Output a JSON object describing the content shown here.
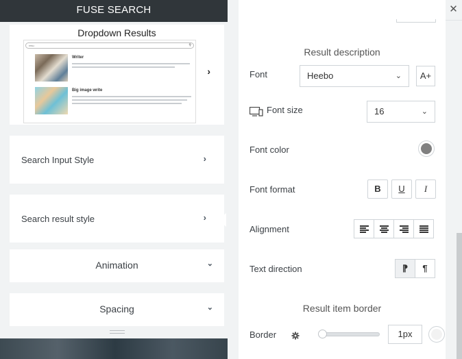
{
  "app": {
    "title": "FUSE SEARCH",
    "close_symbol": "✕"
  },
  "preview": {
    "title": "Dropdown Results",
    "search_value": "resu",
    "items": [
      {
        "title": "Writer"
      },
      {
        "title": "Big image write"
      }
    ]
  },
  "nav": {
    "search_input_style": "Search Input Style",
    "search_result_style": "Search result style",
    "animation": "Animation",
    "spacing": "Spacing"
  },
  "settings": {
    "result_description_title": "Result description",
    "font_label": "Font",
    "font_value": "Heebo",
    "font_add_symbol": "A+",
    "font_size_label": "Font size",
    "font_size_value": "16",
    "font_color_label": "Font color",
    "font_color": "#808080",
    "font_format_label": "Font format",
    "format_bold": "B",
    "format_underline": "U",
    "format_italic": "I",
    "alignment_label": "Alignment",
    "text_direction_label": "Text direction",
    "direction_ltr": "⁋",
    "direction_rtl": "¶",
    "result_item_border_title": "Result item border",
    "border_label": "Border",
    "border_value": "1px",
    "border_color": "#f2f2f2",
    "border_level": 0
  },
  "colors": {
    "header_bg": "#30363a",
    "panel_bg": "#f1f3f4",
    "card_bg": "#ffffff"
  }
}
